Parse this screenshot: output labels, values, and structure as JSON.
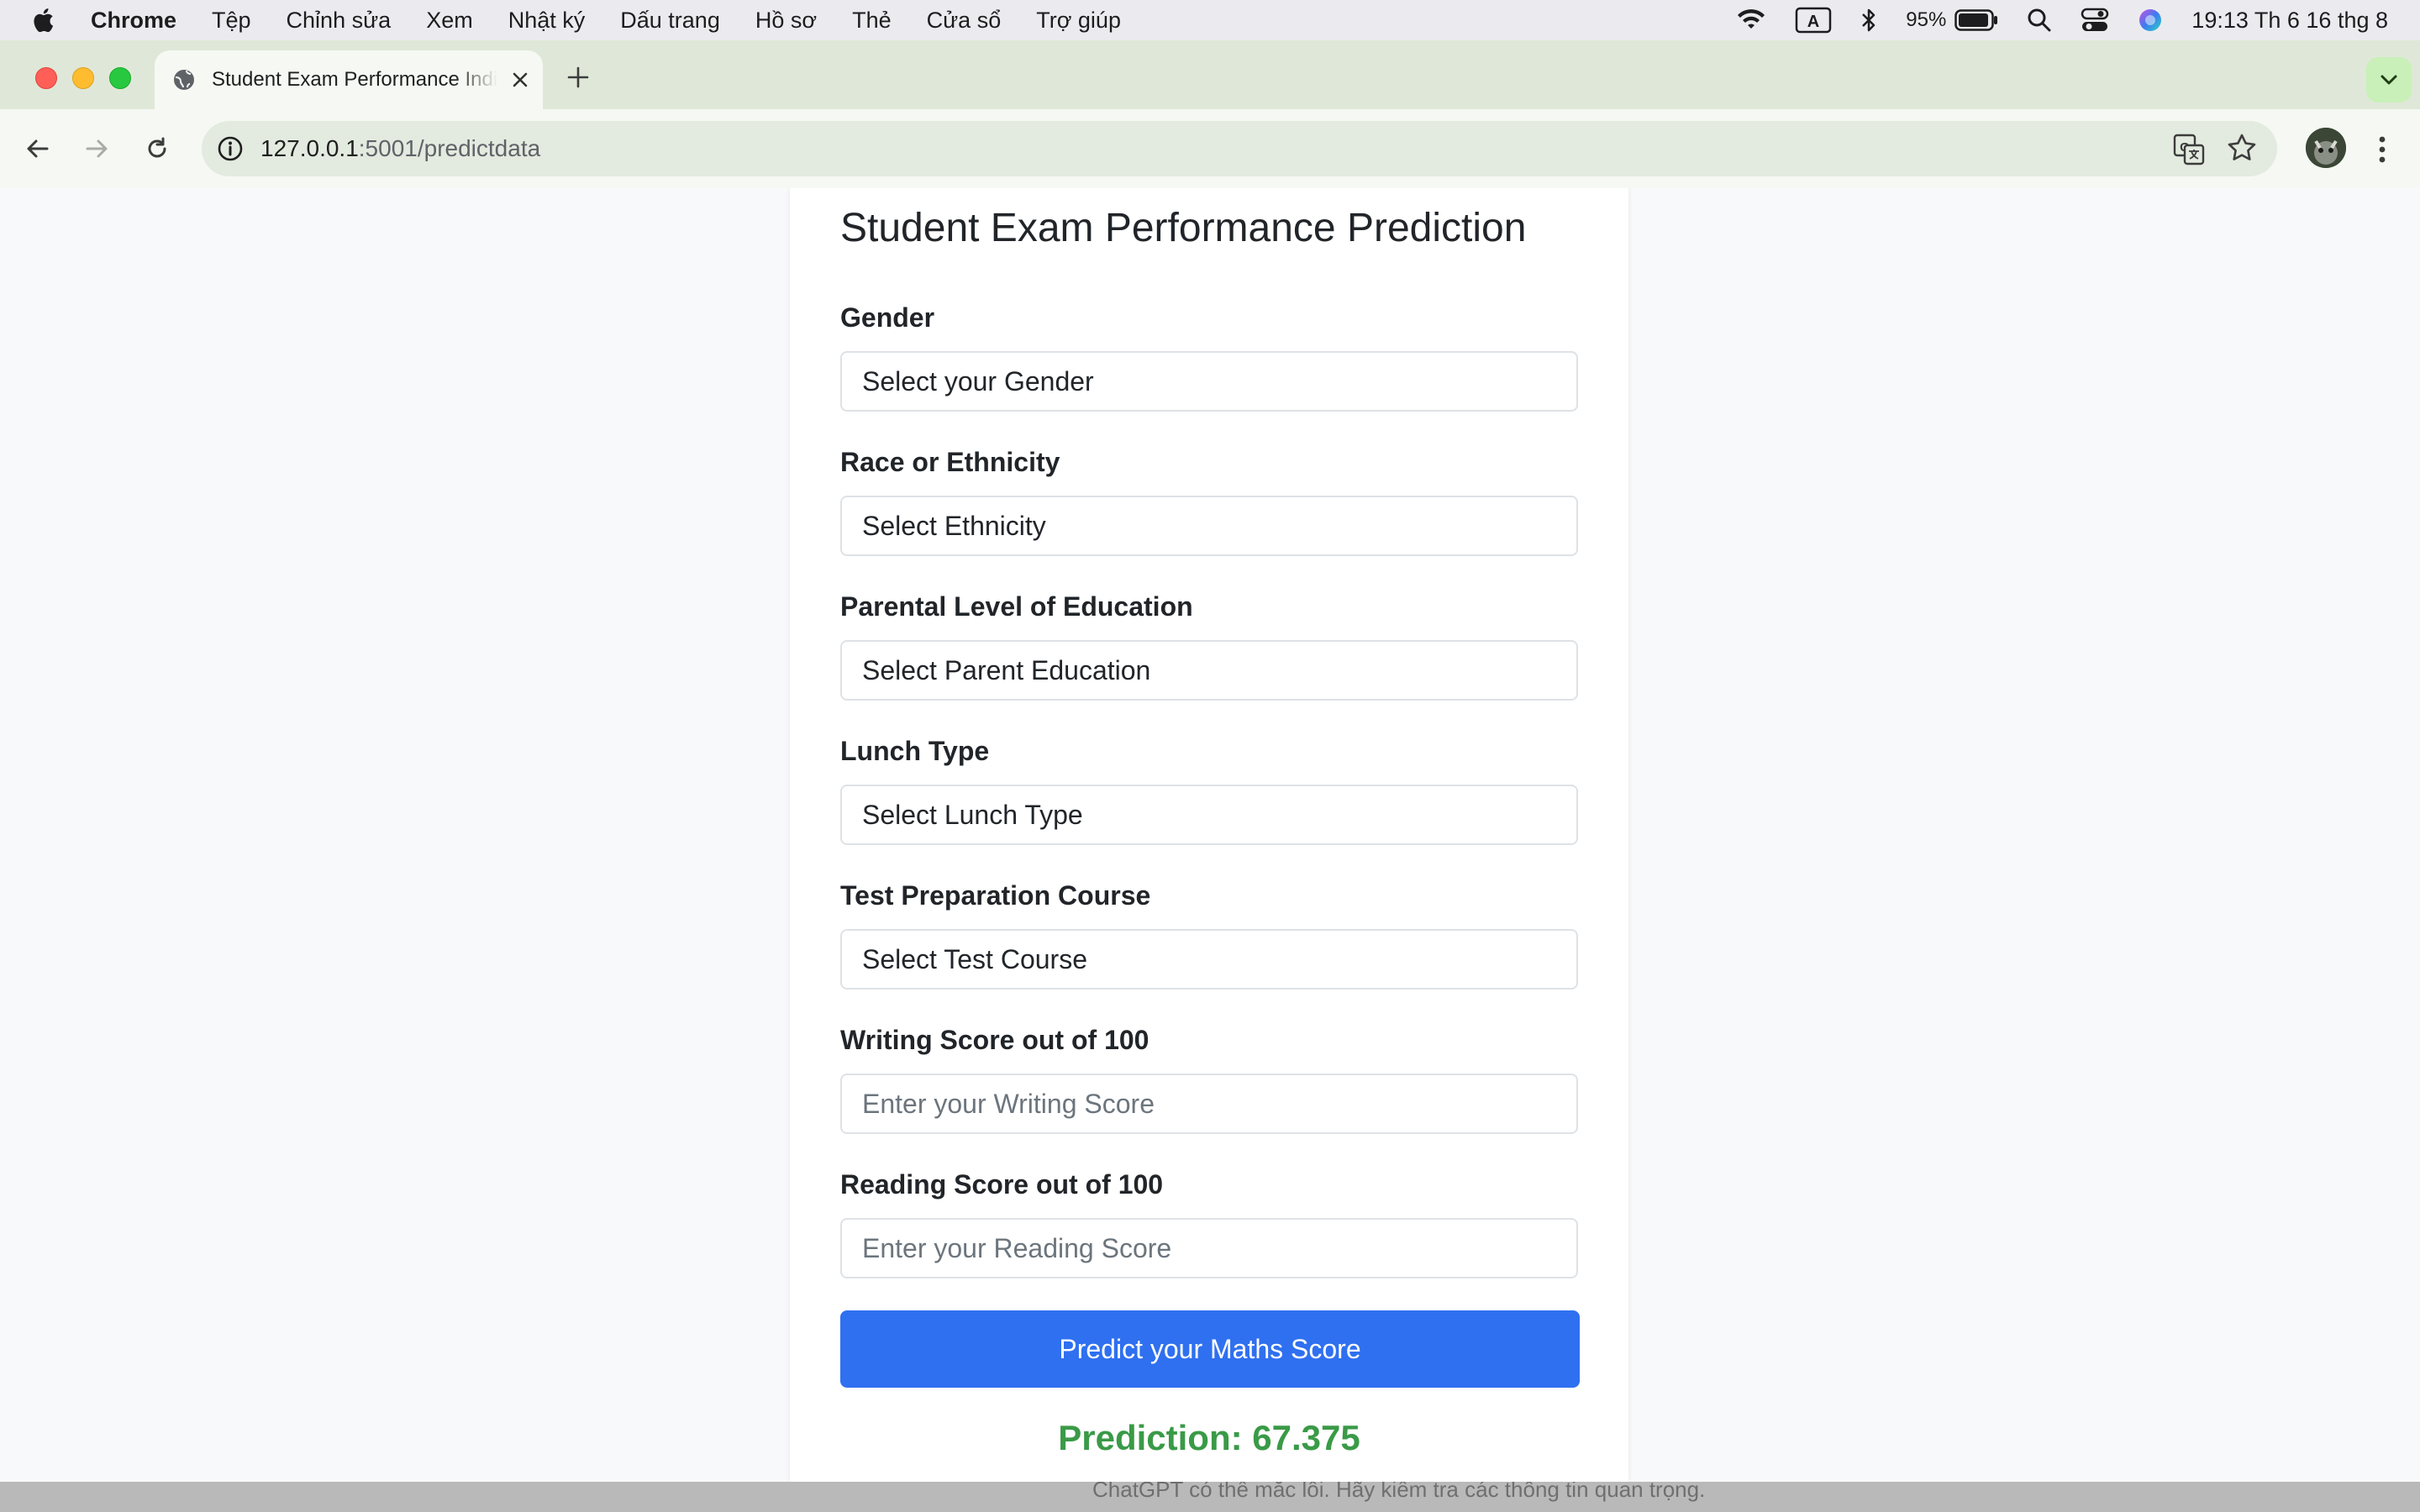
{
  "menubar": {
    "app": "Chrome",
    "items": [
      "Tệp",
      "Chỉnh sửa",
      "Xem",
      "Nhật ký",
      "Dấu trang",
      "Hồ sơ",
      "Thẻ",
      "Cửa sổ",
      "Trợ giúp"
    ],
    "battery_pct": "95%",
    "input_source": "A",
    "clock": "19:13 Th 6 16 thg 8"
  },
  "browser": {
    "tab_title": "Student Exam Performance Indicator",
    "url_host": "127.0.0.1",
    "url_path": ":5001/predictdata"
  },
  "form": {
    "title": "Student Exam Performance Prediction",
    "gender_label": "Gender",
    "gender_value": "Select your Gender",
    "ethnicity_label": "Race or Ethnicity",
    "ethnicity_value": "Select Ethnicity",
    "parent_label": "Parental Level of Education",
    "parent_value": "Select Parent Education",
    "lunch_label": "Lunch Type",
    "lunch_value": "Select Lunch Type",
    "course_label": "Test Preparation Course",
    "course_value": "Select Test Course",
    "writing_label": "Writing Score out of 100",
    "writing_placeholder": "Enter your Writing Score",
    "reading_label": "Reading Score out of 100",
    "reading_placeholder": "Enter your Reading Score",
    "submit_label": "Predict your Maths Score",
    "prediction": "Prediction: 67.375"
  },
  "background_peek": "ChatGPT có thể mắc lỗi. Hãy kiểm tra các thông tin quan trọng.",
  "colors": {
    "primary": "#2f70f0",
    "prediction": "#3a9a47"
  }
}
